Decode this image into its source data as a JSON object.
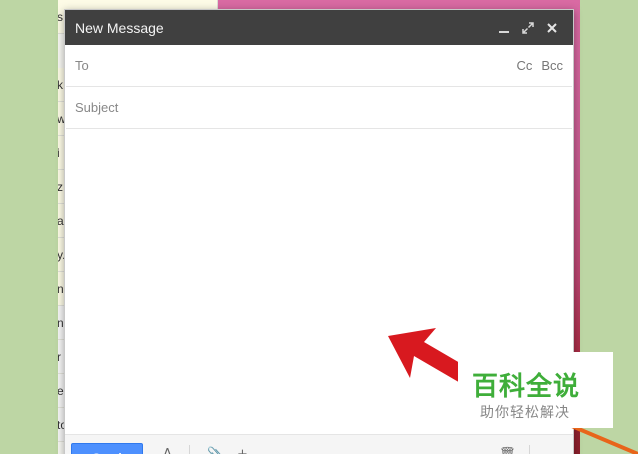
{
  "compose": {
    "title": "New Message",
    "to": {
      "label": "To",
      "value": ""
    },
    "cc_label": "Cc",
    "bcc_label": "Bcc",
    "subject": {
      "placeholder": "Subject",
      "value": ""
    },
    "body": {
      "value": ""
    },
    "send_label": "Send",
    "format_icon_glyph": "A",
    "attach_icon_glyph": "📎",
    "more_icon_glyph": "+",
    "trash_icon_glyph": "🗑"
  },
  "inbox_strip": {
    "row_letters": [
      "s",
      "k",
      "w",
      "i",
      "z",
      "a",
      "y.",
      "n",
      "n",
      "r",
      "e",
      "to"
    ]
  },
  "watermark": {
    "title": "百科全说",
    "subtitle": "助你轻松解决"
  },
  "colors": {
    "header_bg": "#404040",
    "send_button": "#4d90fe",
    "annotation_arrow": "#d8191f",
    "annotation_line": "#e8651a",
    "watermark_green": "#3fae3a"
  },
  "icons": [
    "minimize-icon",
    "popout-icon",
    "close-icon",
    "attach-icon",
    "trash-icon"
  ]
}
